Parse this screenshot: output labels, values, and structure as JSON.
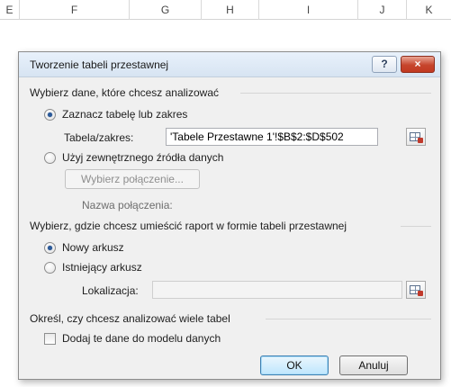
{
  "spreadsheet": {
    "columns": [
      "E",
      "F",
      "G",
      "H",
      "I",
      "J",
      "K"
    ]
  },
  "dialog": {
    "title": "Tworzenie tabeli przestawnej",
    "help_label": "?",
    "close_label": "×",
    "choose_data_section": "Wybierz dane, które chcesz analizować",
    "option_table_range": "Zaznacz tabelę lub zakres",
    "table_range_label": "Tabela/zakres:",
    "table_range_value": "'Tabele Przestawne 1'!$B$2:$D$502",
    "option_external_source": "Użyj zewnętrznego źródła danych",
    "choose_connection_button": "Wybierz połączenie...",
    "connection_name_label": "Nazwa połączenia:",
    "placement_section": "Wybierz, gdzie chcesz umieścić raport w formie tabeli przestawnej",
    "option_new_sheet": "Nowy arkusz",
    "option_existing_sheet": "Istniejący arkusz",
    "location_label": "Lokalizacja:",
    "location_value": "",
    "multiple_tables_section": "Określ, czy chcesz analizować wiele tabel",
    "add_to_model_label": "Dodaj te dane do modelu danych",
    "ok_button": "OK",
    "cancel_button": "Anuluj"
  },
  "state": {
    "data_source": "table_range",
    "placement": "new_sheet",
    "add_to_data_model": false
  },
  "colors": {
    "dialog_bg": "#f0f0f0",
    "close_button": "#c6452c",
    "radio_dot": "#2b5a9a",
    "default_button_border": "#3c7fb1"
  }
}
